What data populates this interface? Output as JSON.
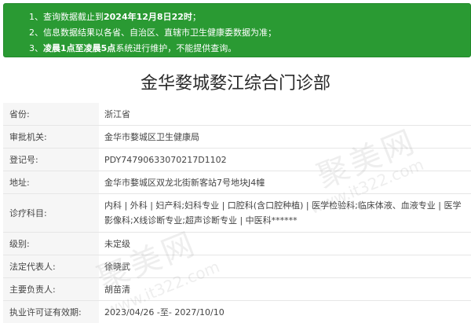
{
  "notice": {
    "lines": [
      {
        "num": "1、",
        "parts": [
          {
            "t": "查询数据截止到"
          },
          {
            "t": "2024年12月8日22时",
            "b": true
          },
          {
            "t": "；"
          }
        ]
      },
      {
        "num": "2、",
        "parts": [
          {
            "t": "信息数据结果以各省、自治区、直辖市卫生健康委数据为准；"
          }
        ]
      },
      {
        "num": "3、",
        "parts": [
          {
            "t": "凌晨1点至凌晨5点",
            "b": true
          },
          {
            "t": "系统进行维护，不能提供查询。"
          }
        ]
      }
    ]
  },
  "title": "金华婺城婺江综合门诊部",
  "rows": [
    {
      "label": "省份:",
      "value": "浙江省"
    },
    {
      "label": "审批机关:",
      "value": "金华市婺城区卫生健康局"
    },
    {
      "label": "登记号:",
      "value": "PDY74790633070217D1102"
    },
    {
      "label": "地址:",
      "value": "金华市婺城区双龙北街新客站7号地块J4幢"
    },
    {
      "label": "诊疗科目:",
      "value": "内科 | 外科 | 妇产科;妇科专业 | 口腔科(含口腔种植) | 医学检验科;临床体液、血液专业 | 医学影像科;X线诊断专业;超声诊断专业 | 中医科******",
      "tall": true
    },
    {
      "label": "级别:",
      "value": "未定级"
    },
    {
      "label": "法定代表人:",
      "value": "徐晓武"
    },
    {
      "label": "主要负责人:",
      "value": "胡苗清"
    },
    {
      "label": "执业许可证有效期:",
      "value": "2023/04/26 -至- 2027/10/10"
    }
  ],
  "watermark": {
    "big": "聚美网",
    "small": "www.it322.com"
  }
}
